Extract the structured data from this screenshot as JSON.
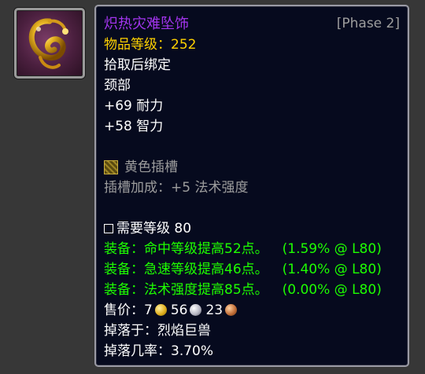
{
  "item": {
    "name": "炽热灾难坠饰",
    "phase": "[Phase 2]",
    "item_level": "物品等级：252",
    "binding": "拾取后绑定",
    "slot": "颈部",
    "stats": [
      "+69 耐力",
      "+58 智力"
    ],
    "socket": {
      "icon": "yellow-socket-icon",
      "label": "黄色插槽",
      "bonus": "插槽加成：+5 法术强度"
    },
    "required_level": "需要等级 80",
    "equip_effects": [
      {
        "text": "装备：命中等级提高52点。",
        "percent": "(1.59% @ L80)"
      },
      {
        "text": "装备：急速等级提高46点。",
        "percent": "(1.40% @ L80)"
      },
      {
        "text": "装备：法术强度提高85点。",
        "percent": "(0.00% @ L80)"
      }
    ],
    "sell_price": {
      "label": "售价：",
      "gold": "7",
      "silver": "56",
      "copper": "23"
    },
    "dropped_by": "掉落于：烈焰巨兽",
    "drop_rate": "掉落几率：3.70%"
  },
  "colors": {
    "epic": "#a335ee",
    "item_level": "#ffd100",
    "equip": "#1eff00",
    "gray": "#9d9d9d",
    "tooltip_bg": "#060a1e",
    "page_bg": "#373737"
  }
}
